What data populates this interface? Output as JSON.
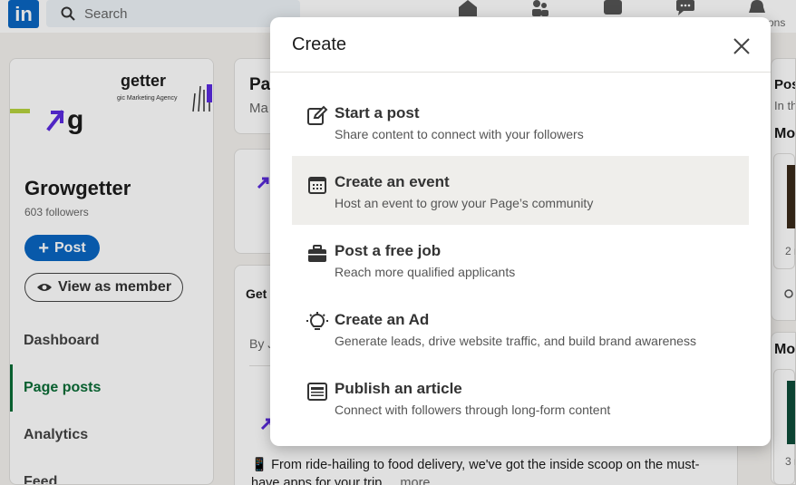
{
  "nav": {
    "logo": "in",
    "search_placeholder": "Search",
    "truncated_label": "ons"
  },
  "left": {
    "banner_text": "getter",
    "banner_subtext": "gic Marketing Agency",
    "page_name": "Growgetter",
    "followers": "603 followers",
    "post_button": "Post",
    "view_button": "View as member",
    "menu": [
      {
        "label": "Dashboard",
        "active": false
      },
      {
        "label": "Page posts",
        "active": true
      },
      {
        "label": "Analytics",
        "active": false
      },
      {
        "label": "Feed",
        "active": false
      }
    ]
  },
  "middle": {
    "card1_title": "Pa",
    "card1_sub": "Ma",
    "card3_title": "Get",
    "card3_by": "By J",
    "post_text_line1": "From ride-hailing to food delivery, we've got the inside scoop on the must-",
    "post_text_line2": "have apps for your trip.",
    "more": "...more"
  },
  "right": {
    "title1": "Pos",
    "sub1": "In th",
    "title2": "Mo",
    "count1": "2 r",
    "title3": "Mo",
    "count2": "3 r"
  },
  "modal": {
    "title": "Create",
    "options": [
      {
        "icon": "edit-icon",
        "title": "Start a post",
        "desc": "Share content to connect with your followers"
      },
      {
        "icon": "calendar-icon",
        "title": "Create an event",
        "desc": "Host an event to grow your Page’s community"
      },
      {
        "icon": "briefcase-icon",
        "title": "Post a free job",
        "desc": "Reach more qualified applicants"
      },
      {
        "icon": "lightbulb-icon",
        "title": "Create an Ad",
        "desc": "Generate leads, drive website traffic, and build brand awareness"
      },
      {
        "icon": "article-icon",
        "title": "Publish an article",
        "desc": "Connect with followers through long-form content"
      }
    ]
  },
  "colors": {
    "brand_blue": "#0a66c2",
    "active_green": "#0a6d36",
    "logo_purple": "#5b2be0",
    "banner_lime": "#b7d33f"
  }
}
